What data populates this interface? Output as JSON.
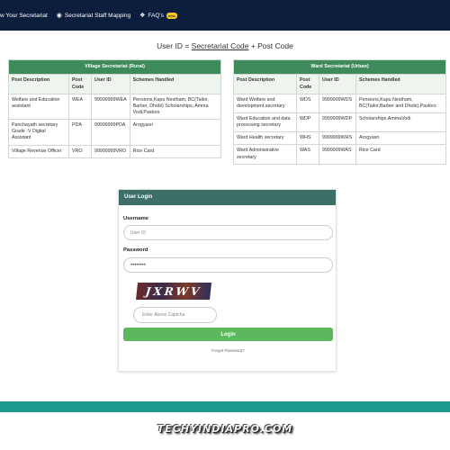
{
  "nav": {
    "items": [
      {
        "label": "w Your Secretariat",
        "icon": ""
      },
      {
        "label": "Secretariat Staff Mapping",
        "icon": "staff-icon"
      },
      {
        "label": "FAQ's",
        "icon": "faq-icon",
        "badge": "new"
      }
    ]
  },
  "userid": {
    "prefix": "User ID = ",
    "code": "Secretariat Code",
    "suffix": " + Post Code"
  },
  "village": {
    "title": "Village Secretariat (Rural)",
    "headers": [
      "Post Description",
      "Post Code",
      "User ID",
      "Schemes Handled"
    ],
    "rows": [
      [
        "Welfare and Education assistant",
        "WEA",
        "99999999WEA",
        "Pensions,Kapu Nestham, BC(Tailor, Barber, Dhobi) Scholarships, Amma Vodi,Pastors"
      ],
      [
        "Panchayath secretary Grade -V Digital Assistant",
        "PDA",
        "99999999PDA",
        "Arogyasri"
      ],
      [
        "Village Revenue Officer",
        "VRO",
        "99999999VRO",
        "Rice Card"
      ]
    ]
  },
  "ward": {
    "title": "Ward Secretariat (Urban)",
    "headers": [
      "Post Description",
      "Post Code",
      "User ID",
      "Schemes Handled"
    ],
    "rows": [
      [
        "Ward Welfare and development secretary",
        "WDS",
        "9999999WDS",
        "Pensions,Kapu Nestham, BC(Tailor,Barber and Dhobi),Pastors"
      ],
      [
        "Ward Education and data processing secretary",
        "WDP",
        "9999999WDP",
        "Scholarships,AmmaVodi"
      ],
      [
        "Ward Health secretary",
        "WHS",
        "9999999WHS",
        "Arogyasri"
      ],
      [
        "Ward Administrative secretary",
        "WAS",
        "9999999WAS",
        "Rice Card"
      ]
    ]
  },
  "login": {
    "title": "User Login",
    "username_label": "Username",
    "username_placeholder": "User ID",
    "password_label": "Password",
    "password_value": "••••••••",
    "captcha_text": "JXRWV",
    "captcha_placeholder": "Enter Above Captcha",
    "login_button": "Login",
    "forgot_link": "Forgot Password?"
  },
  "brand": "TECHYINDIAPRO.COM"
}
